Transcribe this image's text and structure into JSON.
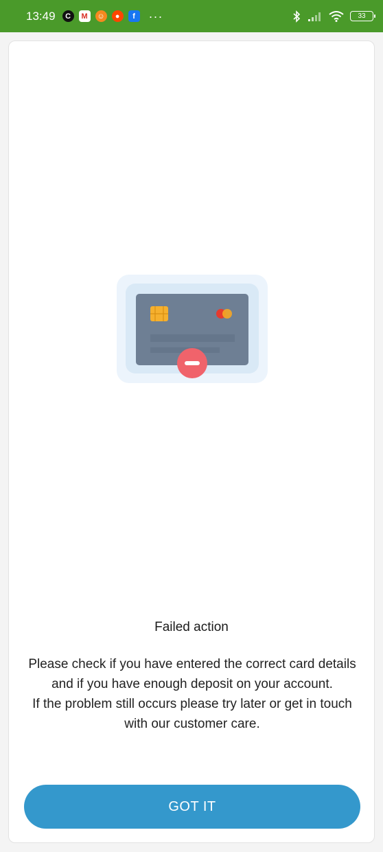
{
  "status_bar": {
    "time": "13:49",
    "notifications": [
      {
        "icon": "c-app-icon",
        "glyph": "C"
      },
      {
        "icon": "gmail-icon",
        "glyph": "M"
      },
      {
        "icon": "orange-app-icon",
        "glyph": "☺"
      },
      {
        "icon": "reddit-icon",
        "glyph": "●"
      },
      {
        "icon": "facebook-icon",
        "glyph": "f"
      }
    ],
    "more": "···",
    "battery": "33"
  },
  "dialog": {
    "illustration_icon": "failed-card-icon",
    "title": "Failed action",
    "message_line1": "Please check if you have entered the correct card details and if you have enough deposit on your account.",
    "message_line2": "If the problem still occurs please try later or get in touch with our customer care.",
    "button_label": "GOT IT"
  },
  "colors": {
    "status_bar": "#4a9a2a",
    "button": "#3498cc",
    "card_face": "#6e7f94",
    "error_badge": "#f0636b"
  }
}
